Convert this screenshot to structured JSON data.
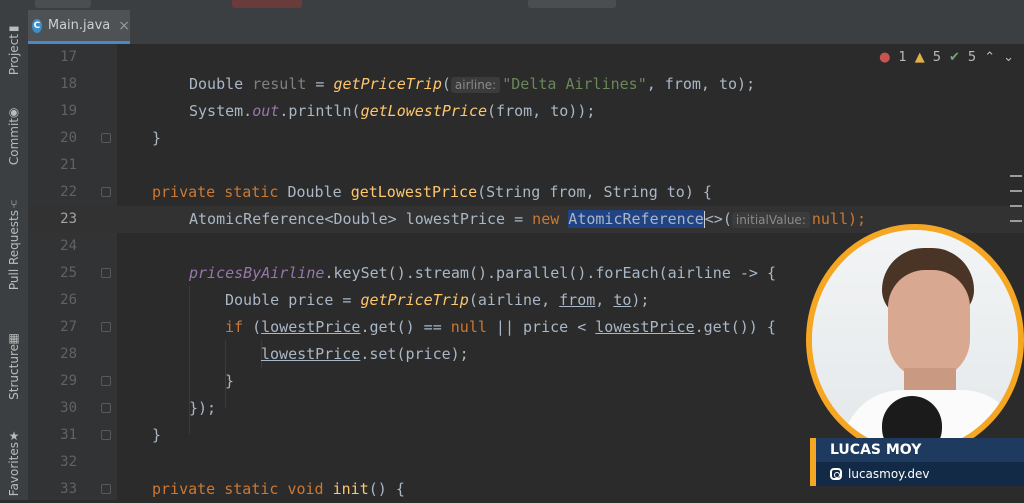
{
  "window": {
    "top_segments": 2
  },
  "tool_strip": {
    "tabs": [
      {
        "label": "Project",
        "icon": "folder-icon"
      },
      {
        "label": "Commit",
        "icon": "commit-icon"
      },
      {
        "label": "Pull Requests",
        "icon": "pull-request-icon"
      },
      {
        "label": "Structure",
        "icon": "structure-icon"
      },
      {
        "label": "Favorites",
        "icon": "star-icon"
      }
    ]
  },
  "editor_tabs": [
    {
      "label": "Main.java",
      "icon": "java-class-icon",
      "close": "×"
    }
  ],
  "inspections": {
    "errors": "1",
    "warnings": "5",
    "weak_warnings": "5"
  },
  "code_lines": [
    {
      "num": "17"
    },
    {
      "num": "18"
    },
    {
      "num": "19"
    },
    {
      "num": "20"
    },
    {
      "num": "21"
    },
    {
      "num": "22"
    },
    {
      "num": "23"
    },
    {
      "num": "24"
    },
    {
      "num": "25"
    },
    {
      "num": "26"
    },
    {
      "num": "27"
    },
    {
      "num": "28"
    },
    {
      "num": "29"
    },
    {
      "num": "30"
    },
    {
      "num": "31"
    },
    {
      "num": "32"
    },
    {
      "num": "33"
    }
  ],
  "code": {
    "l18_a": "Double ",
    "l18_b": "result",
    "l18_c": " = ",
    "l18_d": "getPriceTrip",
    "l18_e": "(",
    "l18_hint": "airline:",
    "l18_str": "\"Delta Airlines\"",
    "l18_f": ", from, to);",
    "l19_a": "System.",
    "l19_b": "out",
    "l19_c": ".println(",
    "l19_d": "getLowestPrice",
    "l19_e": "(from, to));",
    "l20": "}",
    "l22_kw": "private static ",
    "l22_a": "Double ",
    "l22_fn": "getLowestPrice",
    "l22_b": "(String from, String to) {",
    "l23_a": "AtomicReference<Double> lowestPrice = ",
    "l23_kw": "new ",
    "l23_sel": "AtomicReference",
    "l23_b": "<>(",
    "l23_hint": "initialValue:",
    "l23_null": "null",
    "l23_c": ");",
    "l25_field": "pricesByAirline",
    "l25_a": ".keySet().stream().parallel().forEach(airline -> {",
    "l26_a": "Double price = ",
    "l26_fn": "getPriceTrip",
    "l26_b": "(airline, ",
    "l26_from": "from",
    "l26_c": ", ",
    "l26_to": "to",
    "l26_d": ");",
    "l27_kw": "if ",
    "l27_a": "(",
    "l27_v1": "lowestPrice",
    "l27_b": ".get() == ",
    "l27_null": "null",
    "l27_c": " || price < ",
    "l27_v2": "lowestPrice",
    "l27_d": ".get()) {",
    "l28_v": "lowestPrice",
    "l28_a": ".set(price);",
    "l29": "}",
    "l30": "});",
    "l31": "}",
    "l33_kw": "private static void ",
    "l33_fn": "init",
    "l33_a": "() {"
  },
  "presenter": {
    "name": "LUCAS MOY",
    "handle": "lucasmoy.dev",
    "accent": "#f5a623"
  },
  "colors": {
    "editor_bg": "#2b2b2b",
    "keyword": "#cc7832",
    "function": "#ffc66d",
    "string": "#6a8759",
    "field": "#9876aa",
    "selection": "#214283"
  }
}
